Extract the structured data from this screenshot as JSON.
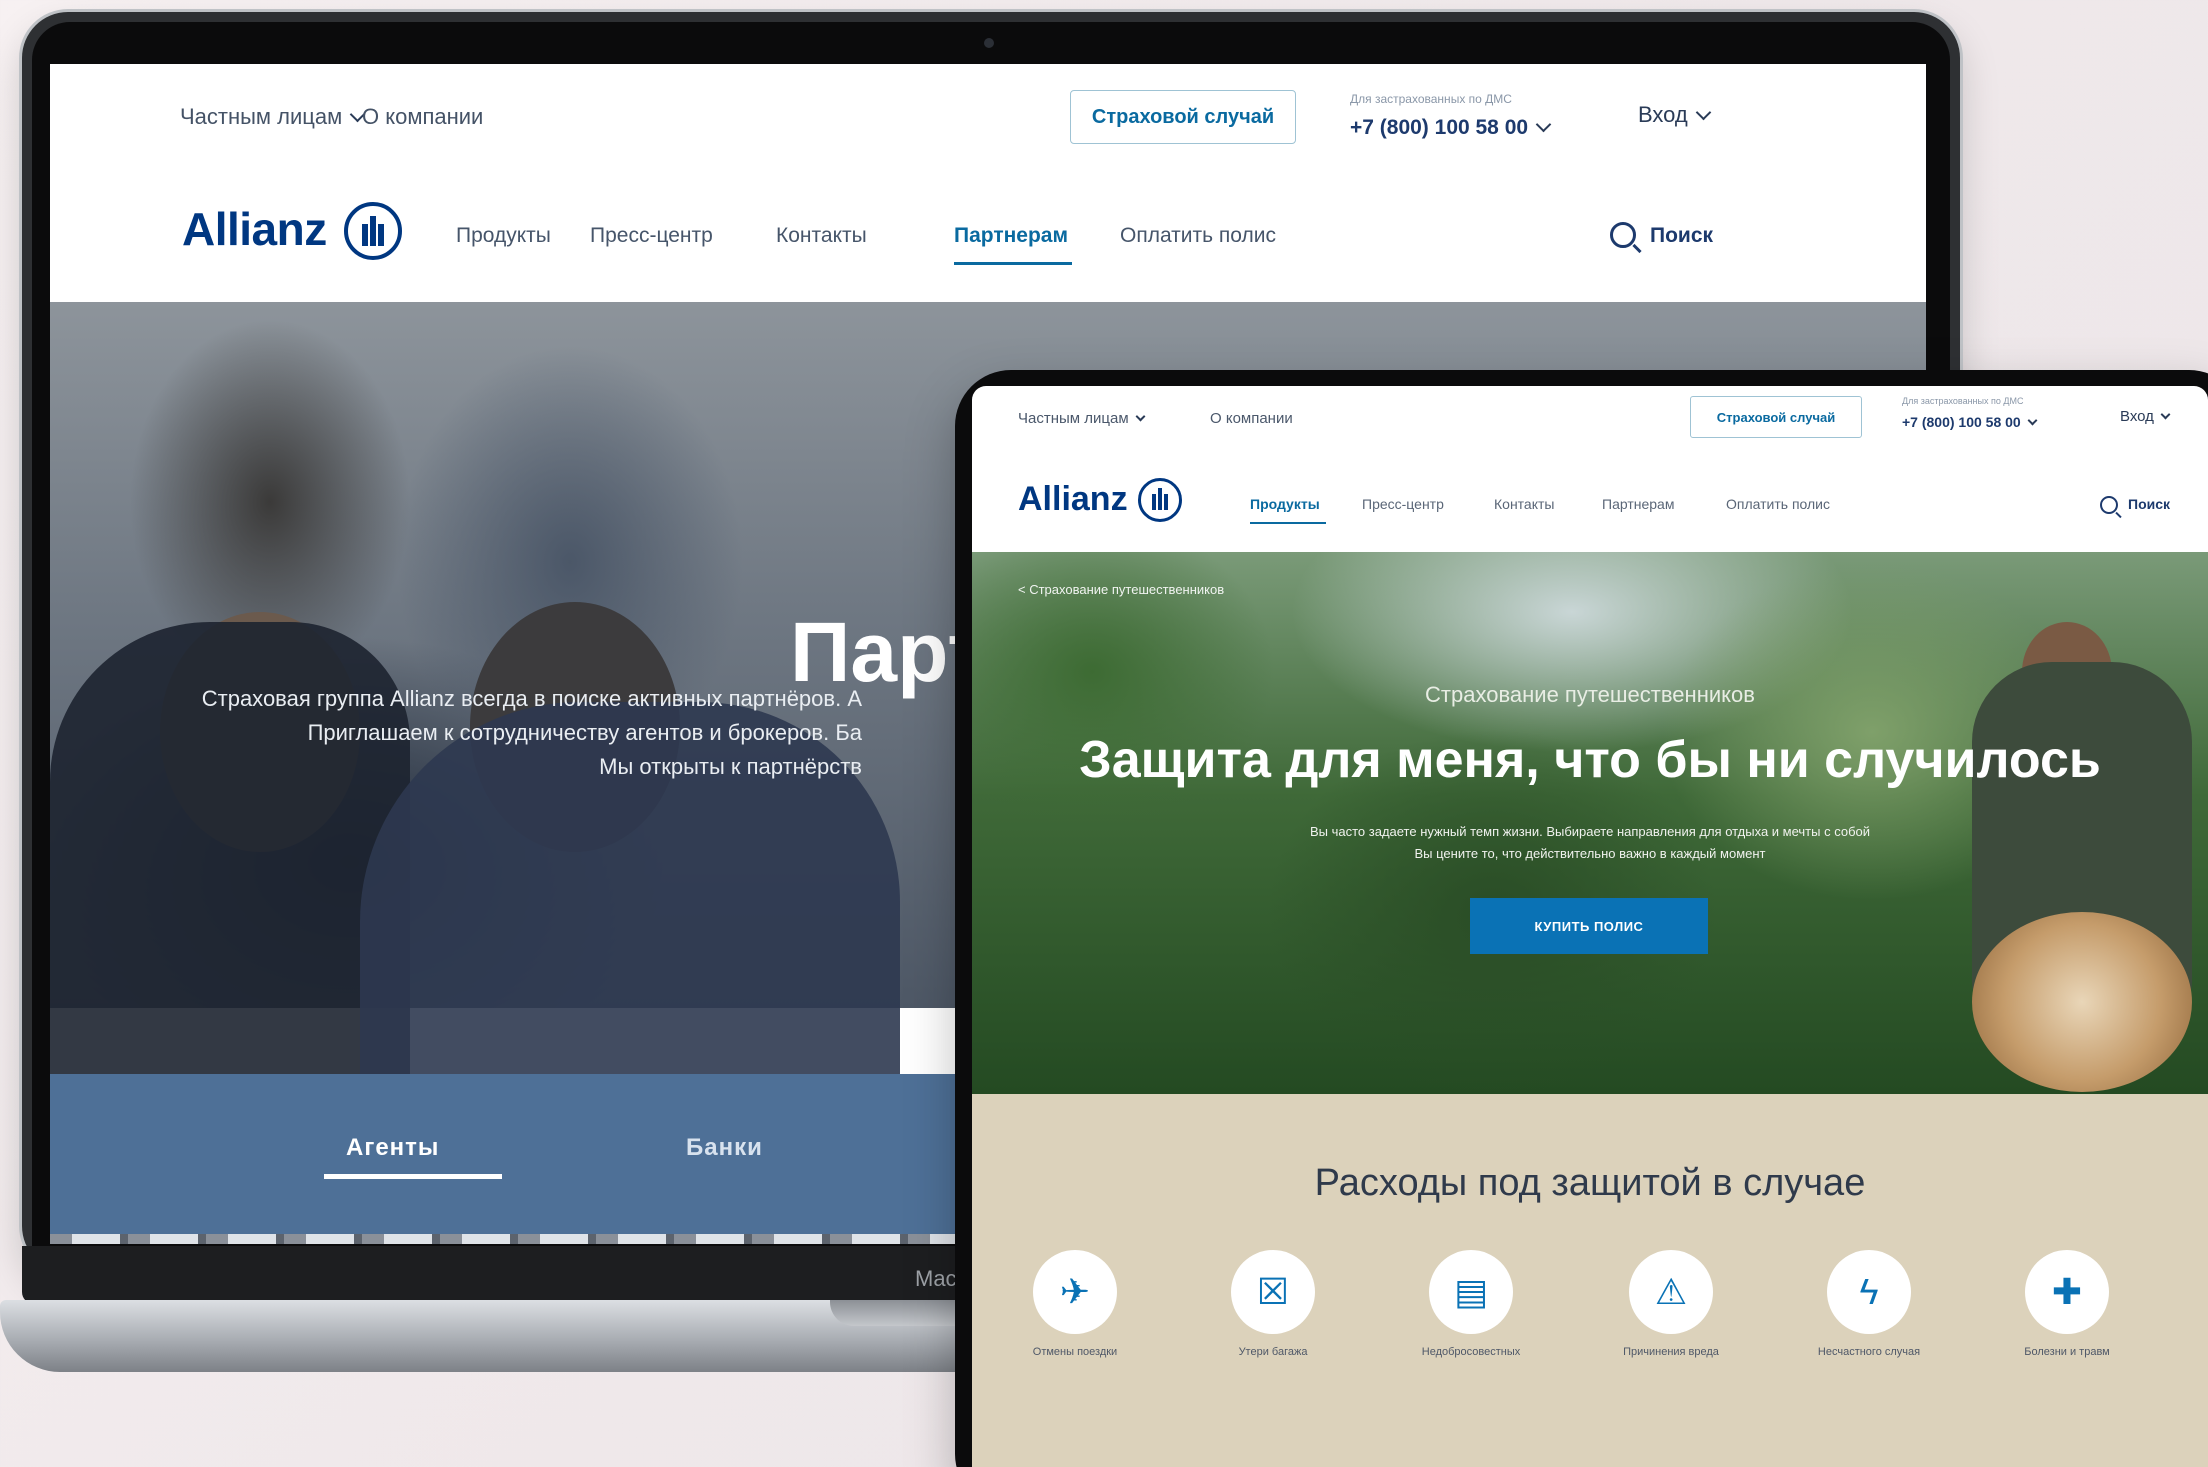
{
  "laptop": {
    "device_label": "Mac",
    "utility": {
      "private_persons": "Частным лицам",
      "about": "О компании",
      "claim_button": "Страховой случай",
      "phone_caption": "Для застрахованных по ДМС",
      "phone": "+7 (800) 100 58 00",
      "login": "Вход"
    },
    "nav": {
      "logo": "Allianz",
      "items": [
        "Продукты",
        "Пресс-центр",
        "Контакты",
        "Партнерам",
        "Оплатить полис"
      ],
      "active_index": 3,
      "search": "Поиск"
    },
    "hero": {
      "title": "Партн",
      "lines": [
        "Страховая группа Allianz всегда в поиске активных партнёров. А",
        "Приглашаем к сотрудничеству агентов и брокеров. Ба",
        "Мы открыты к партнёрств"
      ]
    },
    "tabs": [
      "Агенты",
      "Банки"
    ]
  },
  "tablet": {
    "utility": {
      "private_persons": "Частным лицам",
      "about": "О компании",
      "claim_button": "Страховой случай",
      "phone_caption": "Для застрахованных по ДМС",
      "phone": "+7 (800) 100 58 00",
      "login": "Вход"
    },
    "nav": {
      "logo": "Allianz",
      "items": [
        "Продукты",
        "Пресс-центр",
        "Контакты",
        "Партнерам",
        "Оплатить полис"
      ],
      "active_index": 0,
      "search": "Поиск"
    },
    "hero": {
      "breadcrumb": "< Страхование путешественников",
      "kicker": "Страхование путешественников",
      "title": "Защита для меня, что бы ни случилось",
      "desc_lines": [
        "Вы часто задаете нужный темп жизни. Выбираете направления для отдыха и мечты с собой",
        "Вы цените то, что действительно важно в каждый момент"
      ],
      "buy_button": "КУПИТЬ ПОЛИС"
    },
    "coverage": {
      "title": "Расходы под защитой в случае",
      "items": [
        {
          "icon": "airplane-cancel-icon",
          "glyph": "✈",
          "label": "Отмены поездки"
        },
        {
          "icon": "luggage-icon",
          "glyph": "☒",
          "label": "Утери багажа"
        },
        {
          "icon": "document-icon",
          "glyph": "▤",
          "label": "Недобросовестных"
        },
        {
          "icon": "alarm-icon",
          "glyph": "⚠",
          "label": "Причинения вреда"
        },
        {
          "icon": "lightning-icon",
          "glyph": "ϟ",
          "label": "Несчастного случая"
        },
        {
          "icon": "bandage-icon",
          "glyph": "✚",
          "label": "Болезни и травм"
        }
      ]
    }
  },
  "colors": {
    "brand": "#003781",
    "accent": "#0a72b5",
    "tab_bar": "#4e7097",
    "coverage_bg": "#dcd2bb"
  }
}
